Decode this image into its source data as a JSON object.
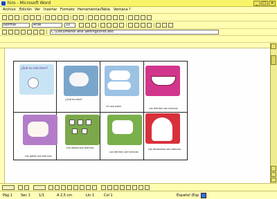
{
  "window": {
    "title": "hiro - Microsoft Word",
    "minimize": "_",
    "maximize": "□",
    "close": "×"
  },
  "menu": [
    "Archivo",
    "Edición",
    "Ver",
    "Insertar",
    "Formato",
    "Herramientas",
    "Tabla",
    "Ventana",
    "?"
  ],
  "toolbar": {
    "style_value": "Normal",
    "font_value": "Arial",
    "size_value": "10",
    "address_value": "C:\\Documents and Settings\\hiro.doc"
  },
  "document": {
    "cover_title": "¿Qué es este lleno?",
    "captions": [
      "¿Qué es esto?",
      "Un oso polar",
      "Las nubes son blancas",
      "Los dientes son blancos",
      "Los gatos son blancos",
      "Los dados son blancos",
      "Los dientes son blancos",
      "Los fantasmas son blancos"
    ]
  },
  "status": {
    "page": "Pág 1",
    "section": "Sec 1",
    "pages": "1/1",
    "position": "A 2,5 cm",
    "line": "Lín 1",
    "col": "Col 1",
    "lang": "Español (Esp"
  },
  "colors": {
    "title_bg": "#f8f46a",
    "toolbar_bg": "#fffdb0",
    "page_bg": "#fefefe"
  }
}
